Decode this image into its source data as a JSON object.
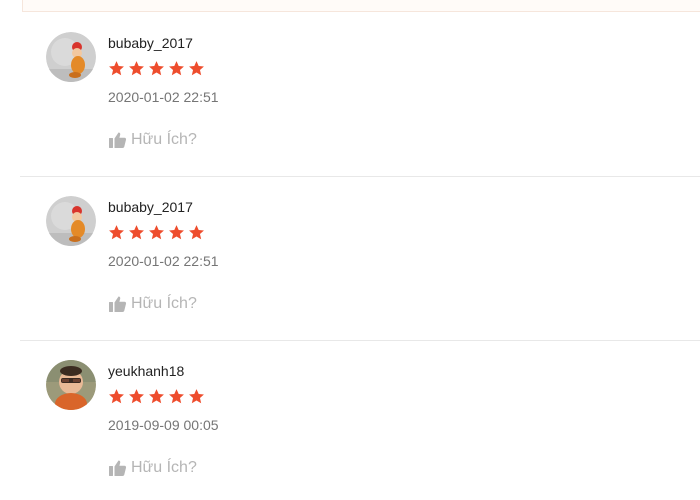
{
  "reviews": [
    {
      "username": "bubaby_2017",
      "rating": 5,
      "timestamp": "2020-01-02 22:51",
      "helpful_label": "Hữu Ích?",
      "avatar": "baby-photo-avatar"
    },
    {
      "username": "bubaby_2017",
      "rating": 5,
      "timestamp": "2020-01-02 22:51",
      "helpful_label": "Hữu Ích?",
      "avatar": "baby-photo-avatar"
    },
    {
      "username": "yeukhanh18",
      "rating": 5,
      "timestamp": "2019-09-09 00:05",
      "helpful_label": "Hữu Ích?",
      "avatar": "child-photo-avatar"
    }
  ],
  "colors": {
    "star": "#ee4d2d",
    "helpful": "#b5b5b5",
    "divider": "#e8e8e8"
  },
  "icons": {
    "rating": "star-icon",
    "helpful": "thumbs-up-icon"
  }
}
